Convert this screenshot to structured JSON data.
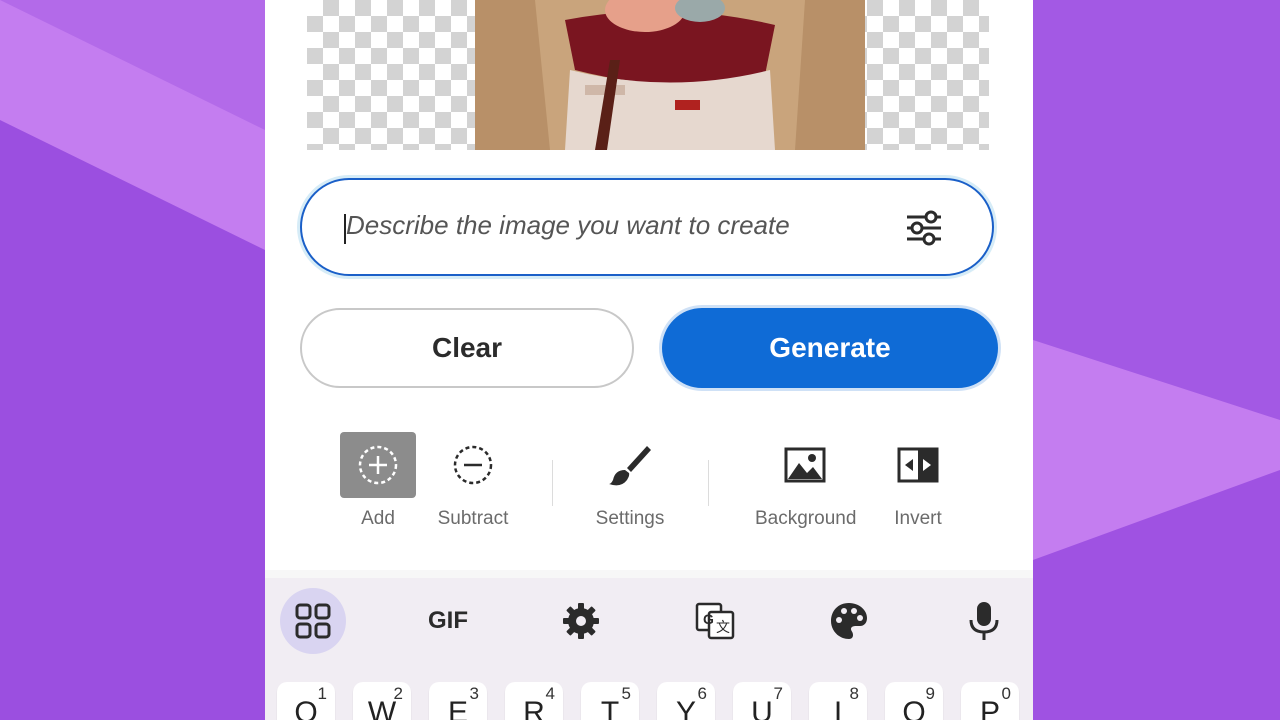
{
  "prompt": {
    "placeholder": "Describe the image you want to create"
  },
  "buttons": {
    "clear": "Clear",
    "generate": "Generate"
  },
  "tools": [
    {
      "label": "Add",
      "icon": "add-selection-icon",
      "active": true
    },
    {
      "label": "Subtract",
      "icon": "subtract-selection-icon"
    },
    {
      "label": "Settings",
      "icon": "brush-icon"
    },
    {
      "label": "Background",
      "icon": "image-icon"
    },
    {
      "label": "Invert",
      "icon": "invert-icon"
    }
  ],
  "keyboard": {
    "toolbar": {
      "gif": "GIF"
    },
    "row1": [
      {
        "ch": "Q",
        "sup": "1"
      },
      {
        "ch": "W",
        "sup": "2"
      },
      {
        "ch": "E",
        "sup": "3"
      },
      {
        "ch": "R",
        "sup": "4"
      },
      {
        "ch": "T",
        "sup": "5"
      },
      {
        "ch": "Y",
        "sup": "6"
      },
      {
        "ch": "U",
        "sup": "7"
      },
      {
        "ch": "I",
        "sup": "8"
      },
      {
        "ch": "O",
        "sup": "9"
      },
      {
        "ch": "P",
        "sup": "0"
      }
    ]
  },
  "colors": {
    "accent": "#0f6bd6",
    "background": "#c47df0",
    "background_dark": "#9b4fe0"
  }
}
